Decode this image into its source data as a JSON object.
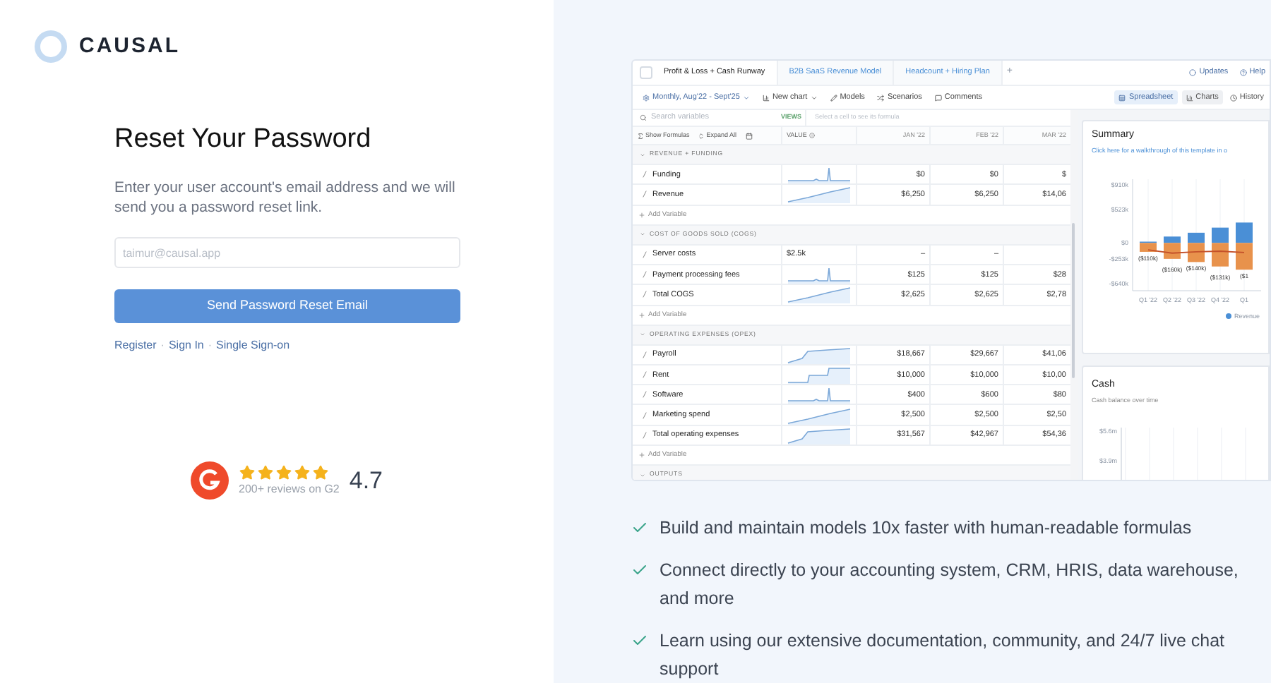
{
  "brand": {
    "name": "CAUSAL"
  },
  "form": {
    "title": "Reset Your Password",
    "description": "Enter your user account's email address and we will send you a password reset link.",
    "email": {
      "placeholder": "taimur@causal.app"
    },
    "submit": "Send Password Reset Email",
    "links": [
      "Register",
      "Sign In",
      "Single Sign-on"
    ],
    "separator": "·"
  },
  "rating": {
    "stars": 5,
    "reviews": "200+ reviews on G2",
    "score": "4.7"
  },
  "app": {
    "tabs": [
      {
        "label": "Profit & Loss + Cash Runway",
        "selected": true
      },
      {
        "label": "B2B SaaS Revenue Model",
        "selected": false
      },
      {
        "label": "Headcount + Hiring Plan",
        "selected": false
      }
    ],
    "add_tab": "+",
    "top_links": [
      "Updates",
      "Help"
    ],
    "toolbar": [
      {
        "label": "Monthly, Aug'22 - Sept'25",
        "kind": "period"
      },
      {
        "label": "New chart",
        "kind": "chart"
      },
      {
        "label": "Models",
        "kind": "models"
      },
      {
        "label": "Scenarios",
        "kind": "scenarios"
      },
      {
        "label": "Comments",
        "kind": "comments"
      }
    ],
    "view_toggle": [
      {
        "label": "Spreadsheet",
        "selected": true
      },
      {
        "label": "Charts",
        "selected": false
      }
    ],
    "history": "History",
    "search": {
      "placeholder": "Search variables"
    },
    "views": "VIEWS",
    "formula_hint": "Select a cell to see its formula",
    "controls": [
      "Show Formulas",
      "Expand All"
    ],
    "columns": [
      "VALUE",
      "JAN '22",
      "FEB '22",
      "MAR '22"
    ],
    "sections": [
      {
        "title": "REVENUE + FUNDING",
        "expanded": true,
        "add": "Add Variable",
        "rows": [
          {
            "name": "Funding",
            "kind": "sparkline",
            "cells": [
              "$0",
              "$0",
              "$"
            ]
          },
          {
            "name": "Revenue",
            "kind": "sparkline",
            "cells": [
              "$6,250",
              "$6,250",
              "$14,06"
            ]
          }
        ]
      },
      {
        "title": "COST OF GOODS SOLD (COGS)",
        "expanded": true,
        "add": "Add Variable",
        "rows": [
          {
            "name": "Server costs",
            "kind": "value",
            "value": "$2.5k",
            "cells": [
              "–",
              "–"
            ]
          },
          {
            "name": "Payment processing fees",
            "kind": "sparkline",
            "cells": [
              "$125",
              "$125",
              "$28"
            ]
          },
          {
            "name": "Total COGS",
            "kind": "sparkline",
            "cells": [
              "$2,625",
              "$2,625",
              "$2,78"
            ]
          }
        ]
      },
      {
        "title": "OPERATING EXPENSES (OPEX)",
        "expanded": true,
        "add": "Add Variable",
        "rows": [
          {
            "name": "Payroll",
            "kind": "sparkline",
            "cells": [
              "$18,667",
              "$29,667",
              "$41,06"
            ]
          },
          {
            "name": "Rent",
            "kind": "sparkline",
            "cells": [
              "$10,000",
              "$10,000",
              "$10,00"
            ]
          },
          {
            "name": "Software",
            "kind": "sparkline",
            "cells": [
              "$400",
              "$600",
              "$80"
            ]
          },
          {
            "name": "Marketing spend",
            "kind": "sparkline",
            "cells": [
              "$2,500",
              "$2,500",
              "$2,50"
            ]
          },
          {
            "name": "Total operating expenses",
            "kind": "sparkline",
            "cells": [
              "$31,567",
              "$42,967",
              "$54,36"
            ]
          }
        ]
      },
      {
        "title": "OUTPUTS",
        "expanded": true
      }
    ],
    "summary": {
      "title": "Summary",
      "link": "Click here for a walkthrough of this template in o",
      "chart_data": {
        "type": "bar",
        "stacked": true,
        "grid": true,
        "ylim": [
          -750,
          1000
        ],
        "categories": [
          "Q1 '22",
          "Q2 '22",
          "Q3 '22",
          "Q4 '22",
          "Q1"
        ],
        "yticks": [
          {
            "value": 910,
            "label": "$910k"
          },
          {
            "value": 523,
            "label": "$523k"
          },
          {
            "value": 0,
            "label": "$0"
          },
          {
            "value": -253,
            "label": "-$253k"
          },
          {
            "value": -640,
            "label": "-$640k"
          }
        ],
        "series": [
          {
            "name": "Revenue",
            "type": "bar",
            "color": "#4a8fd6",
            "values": [
              20,
              100,
              160,
              240,
              320
            ]
          },
          {
            "type": "bar",
            "color": "#e8924c",
            "values": [
              -140,
              -250,
              -300,
              -370,
              -420
            ]
          },
          {
            "type": "line",
            "color": "#c4512a",
            "values": [
              -110,
              -160,
              -140,
              -130,
              -150
            ]
          }
        ],
        "value_labels": [
          "($110k)",
          "($160k)",
          "($140k)",
          "($131k)",
          "($1"
        ]
      }
    },
    "cash": {
      "title": "Cash",
      "subtitle": "Cash balance over time",
      "axis_labels": [
        "$5.6m",
        "$3.9m"
      ]
    }
  },
  "features": [
    "Build and maintain models 10x faster with human-readable formulas",
    "Connect directly to your accounting system, CRM, HRIS, data warehouse, and more",
    "Learn using our extensive documentation, community, and 24/7 live chat support"
  ]
}
